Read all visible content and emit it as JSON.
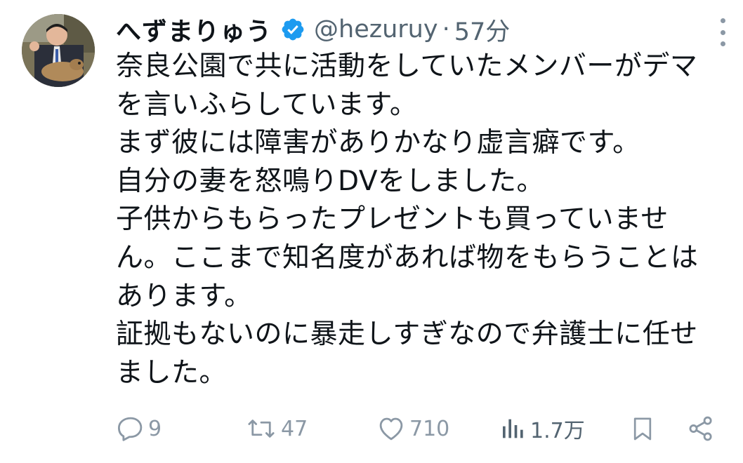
{
  "author": {
    "display_name": "へずまりゅう",
    "handle": "@hezuruy",
    "separator": "·",
    "time": "57分",
    "verified_icon": "verified-badge-icon",
    "verified_color": "#1d9bf0"
  },
  "tweet": {
    "lines": [
      "奈良公園で共に活動をしていたメンバーがデマ",
      "を言いふらしています。",
      "まず彼には障害がありかなり虚言癖です。",
      "自分の妻を怒鳴りDVをしました。",
      "子供からもらったプレゼントも買っていませ",
      "ん。ここまで知名度があれば物をもらうことは",
      "あります。",
      "証拠もないのに暴走しすぎなので弁護士に任せ",
      "ました。"
    ]
  },
  "actions": {
    "reply": {
      "icon": "reply-icon",
      "count": "9"
    },
    "retweet": {
      "icon": "retweet-icon",
      "count": "47"
    },
    "like": {
      "icon": "heart-icon",
      "count": "710"
    },
    "views": {
      "icon": "views-chart-icon",
      "count": "1.7万"
    },
    "bookmark": {
      "icon": "bookmark-icon"
    },
    "share": {
      "icon": "share-icon"
    }
  },
  "colors": {
    "text": "#0f1419",
    "secondary": "#536471",
    "icon_gray": "#8b98a5",
    "verified_blue": "#1d9bf0"
  }
}
